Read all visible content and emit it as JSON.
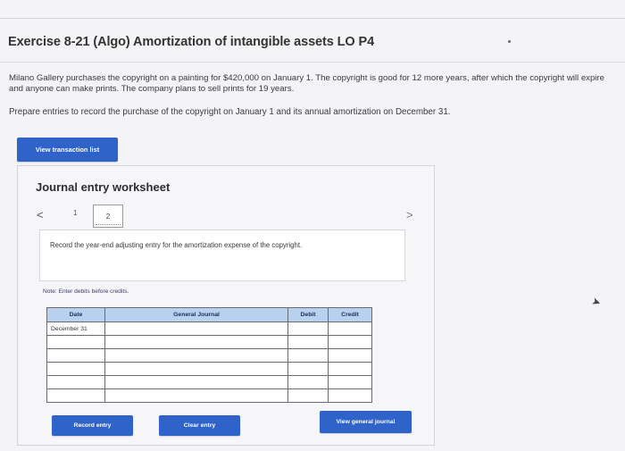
{
  "exercise": {
    "title": "Exercise 8-21 (Algo) Amortization of intangible assets LO P4",
    "paragraph1": "Milano Gallery purchases the copyright on a painting for $420,000 on January 1. The copyright is good for 12 more years, after which the copyright will expire and anyone can make prints. The company plans to sell prints for 19 years.",
    "paragraph2": "Prepare entries to record the purchase of the copyright on January 1 and its annual amortization on December 31."
  },
  "buttons": {
    "view_transaction_list": "View transaction list",
    "record_entry": "Record entry",
    "clear_entry": "Clear entry",
    "view_general_journal": "View general journal"
  },
  "worksheet": {
    "title": "Journal entry worksheet",
    "nav_prev": "<",
    "nav_next": ">",
    "steps": [
      "1",
      "2"
    ],
    "current_step": "2",
    "instruction": "Record the year-end adjusting entry for the amortization expense of the copyright.",
    "note": "Note: Enter debits before credits."
  },
  "journal_table": {
    "headers": {
      "date": "Date",
      "general_journal": "General Journal",
      "debit": "Debit",
      "credit": "Credit"
    },
    "rows": [
      {
        "date": "December 31",
        "account": "",
        "debit": "",
        "credit": ""
      },
      {
        "date": "",
        "account": "",
        "debit": "",
        "credit": ""
      },
      {
        "date": "",
        "account": "",
        "debit": "",
        "credit": ""
      },
      {
        "date": "",
        "account": "",
        "debit": "",
        "credit": ""
      },
      {
        "date": "",
        "account": "",
        "debit": "",
        "credit": ""
      },
      {
        "date": "",
        "account": "",
        "debit": "",
        "credit": ""
      }
    ]
  },
  "colors": {
    "button_blue": "#2f63c9",
    "table_header": "#b7d1ee"
  }
}
